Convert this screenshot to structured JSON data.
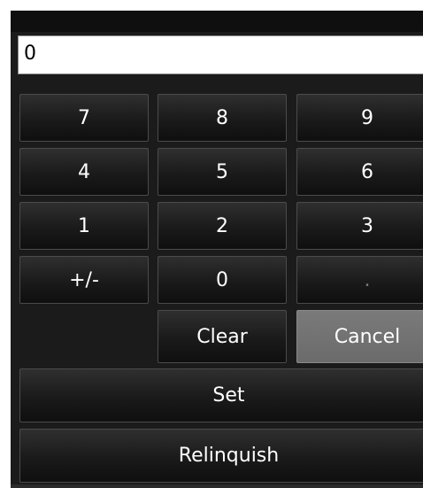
{
  "display": {
    "value": "0"
  },
  "keypad": {
    "row1": [
      "7",
      "8",
      "9"
    ],
    "row2": [
      "4",
      "5",
      "6"
    ],
    "row3": [
      "1",
      "2",
      "3"
    ],
    "row4": [
      "+/-",
      "0",
      "."
    ],
    "clear": "Clear",
    "cancel": "Cancel",
    "set": "Set",
    "relinquish": "Relinquish"
  },
  "colors": {
    "panel_background": "#1b1b1b",
    "display_background": "#ffffff",
    "cancel_highlight": "#6f6f6f"
  }
}
